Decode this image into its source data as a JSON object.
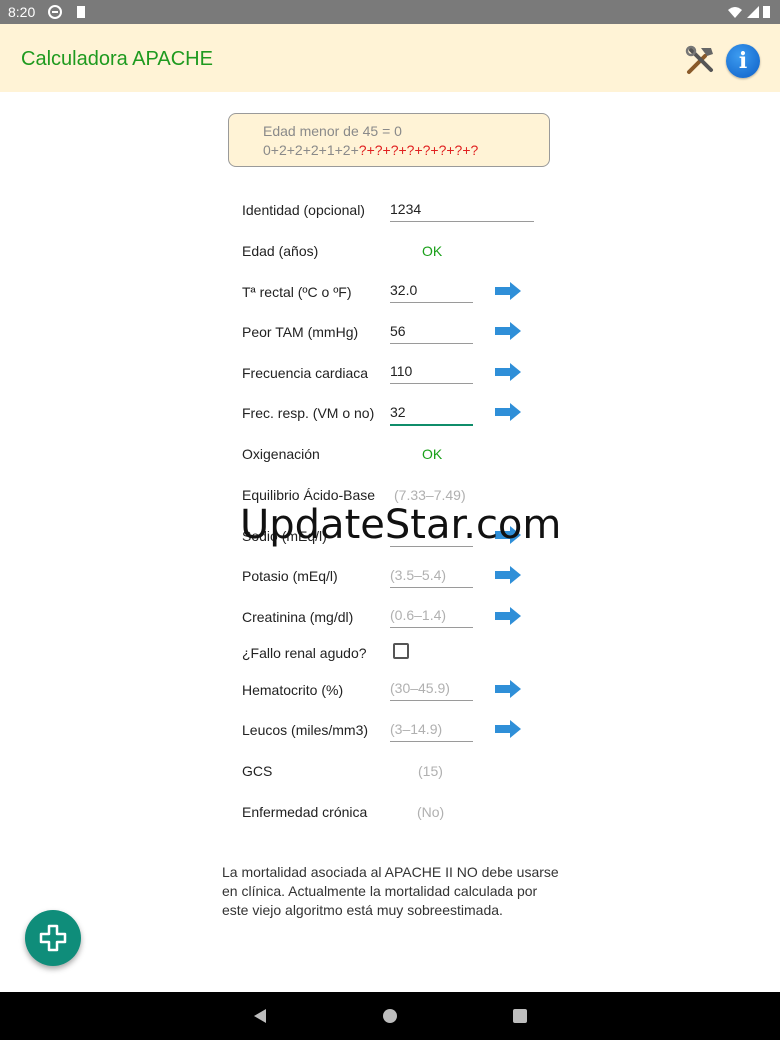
{
  "status_bar": {
    "time": "8:20"
  },
  "app": {
    "title": "Calculadora APACHE"
  },
  "summary": {
    "line1": "Edad menor de 45 = 0",
    "line2_prefix": "0+2+2+2+1+2+",
    "line2_unknown": "?+?+?+?+?+?+?+?"
  },
  "fields": {
    "identidad": {
      "label": "Identidad (opcional)",
      "value": "1234"
    },
    "edad": {
      "label": "Edad (años)",
      "status": "OK"
    },
    "temp": {
      "label": "Tª rectal (ºC o ºF)",
      "value": "32.0"
    },
    "tam": {
      "label": "Peor TAM (mmHg)",
      "value": "56"
    },
    "fc": {
      "label": "Frecuencia cardiaca",
      "value": "110"
    },
    "fr": {
      "label": "Frec. resp. (VM o no)",
      "value": "32"
    },
    "oxi": {
      "label": "Oxigenación",
      "status": "OK"
    },
    "acido": {
      "label": "Equilibrio Ácido-Base",
      "hint": "(7.33–7.49)"
    },
    "sodio": {
      "label": "Sodio (mEq/l)"
    },
    "potasio": {
      "label": "Potasio (mEq/l)",
      "placeholder": "(3.5–5.4)"
    },
    "creat": {
      "label": "Creatinina (mg/dl)",
      "placeholder": "(0.6–1.4)"
    },
    "fallo": {
      "label": "¿Fallo renal agudo?"
    },
    "hto": {
      "label": "Hematocrito (%)",
      "placeholder": "(30–45.9)"
    },
    "leucos": {
      "label": "Leucos (miles/mm3)",
      "placeholder": "(3–14.9)"
    },
    "gcs": {
      "label": "GCS",
      "hint": "(15)"
    },
    "cronica": {
      "label": "Enfermedad crónica",
      "hint": "(No)"
    }
  },
  "footer": {
    "text": "La mortalidad asociada al APACHE II NO debe usarse en clínica. Actualmente la mortalidad calculada por este viejo algoritmo está muy sobreestimada."
  },
  "watermark": {
    "text": "UpdateStar.com"
  },
  "colors": {
    "accent_green": "#1f9a1f",
    "appbar_bg": "#fff3d6",
    "fab_teal": "#0f8d7a",
    "unknown_red": "#e02020"
  },
  "icons": [
    "tools-icon",
    "info-icon",
    "arrow-right-icon",
    "add-icon",
    "back-icon",
    "home-icon",
    "recents-icon",
    "wifi-icon",
    "signal-icon",
    "battery-icon"
  ]
}
